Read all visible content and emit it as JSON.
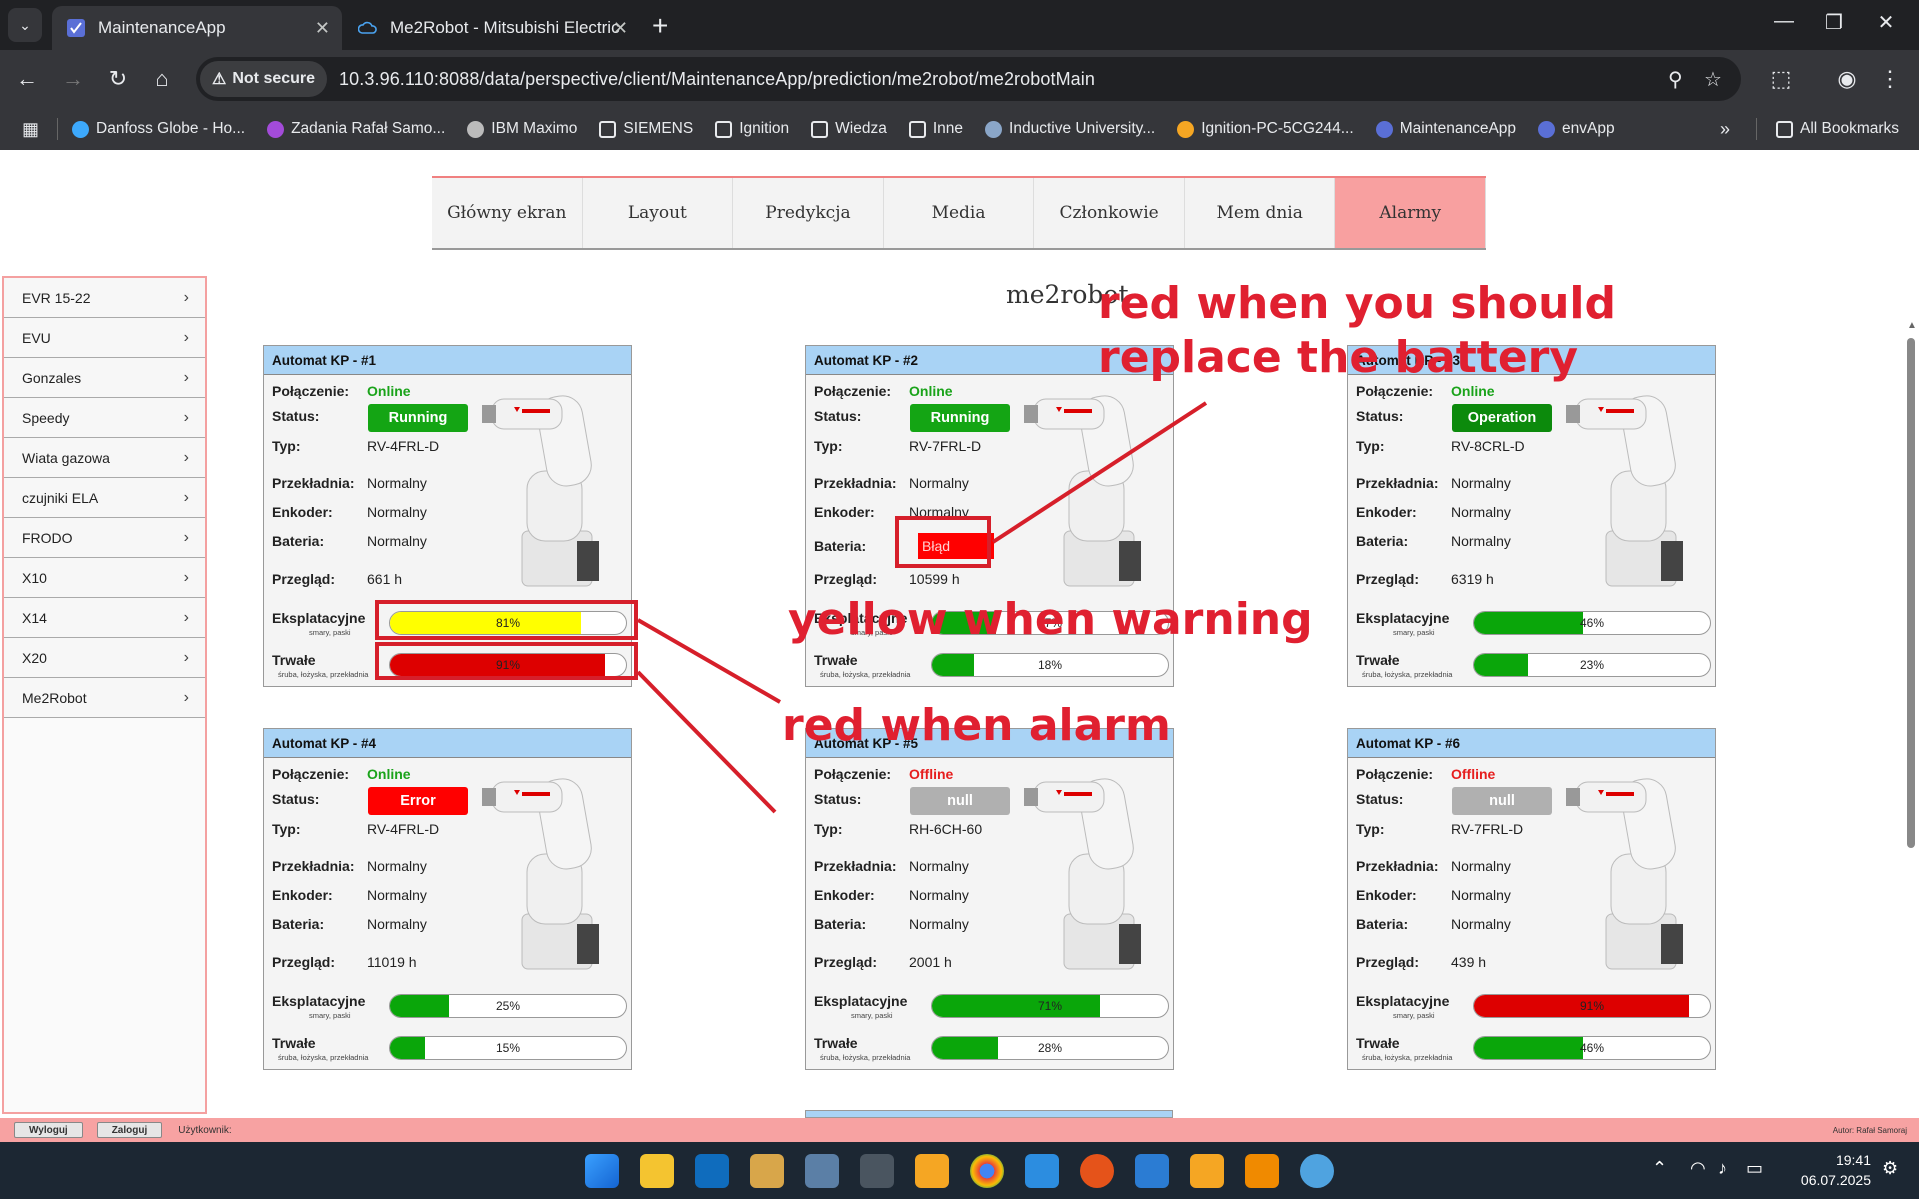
{
  "browser": {
    "tabs": [
      {
        "title": "MaintenanceApp",
        "active": true
      },
      {
        "title": "Me2Robot - Mitsubishi Electric",
        "active": false
      }
    ],
    "security_label": "Not secure",
    "url": "10.3.96.110:8088/data/perspective/client/MaintenanceApp/prediction/me2robot/me2robotMain",
    "bookmarks": [
      {
        "label": "Danfoss Globe - Ho...",
        "icon": "globe-icon",
        "color": "#3da9fc"
      },
      {
        "label": "Zadania Rafał Samo...",
        "icon": "planner-icon",
        "color": "#a34bd9"
      },
      {
        "label": "IBM Maximo",
        "icon": "globe-icon",
        "color": "#bbbbbb"
      },
      {
        "label": "SIEMENS",
        "icon": "folder-icon",
        "color": "#e8eaed"
      },
      {
        "label": "Ignition",
        "icon": "folder-icon",
        "color": "#e8eaed"
      },
      {
        "label": "Wiedza",
        "icon": "folder-icon",
        "color": "#e8eaed"
      },
      {
        "label": "Inne",
        "icon": "folder-icon",
        "color": "#e8eaed"
      },
      {
        "label": "Inductive University...",
        "icon": "iu-icon",
        "color": "#8aa6c8"
      },
      {
        "label": "Ignition-PC-5CG244...",
        "icon": "ignition-icon",
        "color": "#f5a623"
      },
      {
        "label": "MaintenanceApp",
        "icon": "app-icon",
        "color": "#5a6fd6"
      },
      {
        "label": "envApp",
        "icon": "app-icon",
        "color": "#5a6fd6"
      }
    ],
    "all_bookmarks": "All Bookmarks"
  },
  "nav": {
    "items": [
      "Główny ekran",
      "Layout",
      "Predykcja",
      "Media",
      "Członkowie",
      "Mem dnia",
      "Alarmy"
    ],
    "active_index": 6
  },
  "sidebar": {
    "items": [
      "EVR 15-22",
      "EVU",
      "Gonzales",
      "Speedy",
      "Wiata gazowa",
      "czujniki ELA",
      "FRODO",
      "X10",
      "X14",
      "X20",
      "Me2Robot"
    ]
  },
  "page_title": "me2robot",
  "labels": {
    "connection": "Połączenie:",
    "status": "Status:",
    "type": "Typ:",
    "gear": "Przekładnia:",
    "encoder": "Enkoder:",
    "battery": "Bateria:",
    "inspection": "Przegląd:",
    "consumable": "Eksplatacyjne",
    "consumable_sub": "smary, paski",
    "durable": "Trwałe",
    "durable_sub": "śruba, łożyska, przekładnia"
  },
  "robots": [
    {
      "title": "Automat KP - #1",
      "connection": "Online",
      "online": true,
      "status": "Running",
      "status_color": "#14a514",
      "type": "RV-4FRL-D",
      "gear": "Normalny",
      "encoder": "Normalny",
      "battery": "Normalny",
      "battery_error": false,
      "inspection": "661 h",
      "consumable": {
        "value": 81,
        "text": "81%",
        "color": "#ffff00"
      },
      "durable": {
        "value": 91,
        "text": "91%",
        "color": "#dd0000"
      }
    },
    {
      "title": "Automat KP - #2",
      "connection": "Online",
      "online": true,
      "status": "Running",
      "status_color": "#14a514",
      "type": "RV-7FRL-D",
      "gear": "Normalny",
      "encoder": "Normalny",
      "battery": "Błąd",
      "battery_error": true,
      "inspection": "10599 h",
      "consumable": {
        "value": 27,
        "text": "27%",
        "color": "#0aa60a"
      },
      "durable": {
        "value": 18,
        "text": "18%",
        "color": "#0aa60a"
      }
    },
    {
      "title": "Automat KP - #3",
      "connection": "Online",
      "online": true,
      "status": "Operation",
      "status_color": "#0c8a0c",
      "type": "RV-8CRL-D",
      "gear": "Normalny",
      "encoder": "Normalny",
      "battery": "Normalny",
      "battery_error": false,
      "inspection": "6319 h",
      "consumable": {
        "value": 46,
        "text": "46%",
        "color": "#0aa60a"
      },
      "durable": {
        "value": 23,
        "text": "23%",
        "color": "#0aa60a"
      }
    },
    {
      "title": "Automat KP - #4",
      "connection": "Online",
      "online": true,
      "status": "Error",
      "status_color": "#ff0000",
      "type": "RV-4FRL-D",
      "gear": "Normalny",
      "encoder": "Normalny",
      "battery": "Normalny",
      "battery_error": false,
      "inspection": "11019 h",
      "consumable": {
        "value": 25,
        "text": "25%",
        "color": "#0aa60a"
      },
      "durable": {
        "value": 15,
        "text": "15%",
        "color": "#0aa60a"
      }
    },
    {
      "title": "Automat KP - #5",
      "connection": "Offline",
      "online": false,
      "status": "null",
      "status_color": "#b0b0b0",
      "type": "RH-6CH-60",
      "gear": "Normalny",
      "encoder": "Normalny",
      "battery": "Normalny",
      "battery_error": false,
      "inspection": "2001 h",
      "consumable": {
        "value": 71,
        "text": "71%",
        "color": "#0aa60a"
      },
      "durable": {
        "value": 28,
        "text": "28%",
        "color": "#0aa60a"
      }
    },
    {
      "title": "Automat KP - #6",
      "connection": "Offline",
      "online": false,
      "status": "null",
      "status_color": "#b0b0b0",
      "type": "RV-7FRL-D",
      "gear": "Normalny",
      "encoder": "Normalny",
      "battery": "Normalny",
      "battery_error": false,
      "inspection": "439 h",
      "consumable": {
        "value": 91,
        "text": "91%",
        "color": "#dd0000"
      },
      "durable": {
        "value": 46,
        "text": "46%",
        "color": "#0aa60a"
      }
    }
  ],
  "annotations": {
    "battery_note": "red when you should",
    "battery_note2": "replace the battery",
    "warning_note": "yellow when warning",
    "alarm_note": "red when alarm"
  },
  "footer": {
    "logout": "Wyloguj",
    "login": "Zaloguj",
    "user_label": "Użytkownik:",
    "author": "Autor: Rafał Samoraj"
  },
  "taskbar": {
    "time": "19:41",
    "date": "06.07.2025"
  }
}
